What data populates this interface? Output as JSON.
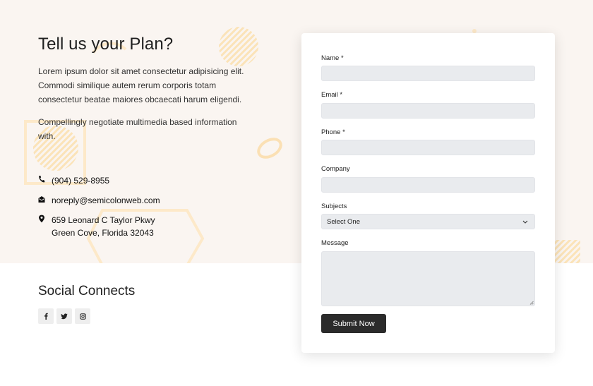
{
  "contact": {
    "title": "Tell us your Plan?",
    "paragraph1": "Lorem ipsum dolor sit amet consectetur adipisicing elit. Commodi similique autem rerum corporis totam consectetur beatae maiores obcaecati harum eligendi.",
    "paragraph2": "Compellingly negotiate multimedia based information with.",
    "phone": "(904) 529-8955",
    "email": "noreply@semicolonweb.com",
    "address_line1": "659 Leonard C Taylor Pkwy",
    "address_line2": "Green Cove, Florida 32043"
  },
  "social": {
    "title": "Social Connects",
    "icons": [
      "facebook-icon",
      "twitter-icon",
      "instagram-icon"
    ]
  },
  "form": {
    "name_label": "Name *",
    "name_value": "",
    "email_label": "Email *",
    "email_value": "",
    "phone_label": "Phone *",
    "phone_value": "",
    "company_label": "Company",
    "company_value": "",
    "subjects_label": "Subjects",
    "subjects_selected": "Select One",
    "message_label": "Message",
    "message_value": "",
    "submit_label": "Submit Now"
  },
  "colors": {
    "band_background": "#faf5f1",
    "decoration": "#fbe6c2",
    "input_background": "#e9ebee",
    "button": "#2b2b2b"
  }
}
